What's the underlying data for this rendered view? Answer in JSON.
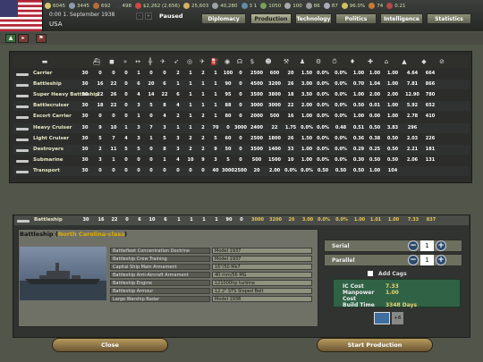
{
  "topbar": {
    "resources": [
      {
        "icon": "energy-icon",
        "value": "6045",
        "color": "#d6c66a"
      },
      {
        "icon": "metal-icon",
        "value": "3445",
        "color": "#8f9bb0"
      },
      {
        "icon": "rare-materials-icon",
        "value": "692",
        "color": "#b46d3a"
      },
      {
        "icon": "oil-icon",
        "value": "498",
        "color": "#3b3b3b"
      },
      {
        "icon": "supplies-icon",
        "value": "$2,262 (2,656)",
        "color": "#c94b43"
      },
      {
        "icon": "money-icon",
        "value": "25,603",
        "color": "#d5b15f"
      },
      {
        "icon": "manpower-icon",
        "value": "40,280",
        "color": "#9ca3a8"
      },
      {
        "icon": "transports-icon",
        "value": "3 1",
        "color": "#5f8ea8"
      },
      {
        "icon": "escorts-icon",
        "value": "1050",
        "color": "#78a05a"
      },
      {
        "icon": "dissent-icon",
        "value": "100",
        "color": "#aaaaaa"
      },
      {
        "icon": "leaders-icon",
        "value": "86",
        "color": "#9c9c9c"
      },
      {
        "icon": "diplo-icon",
        "value": "87",
        "color": "#aab"
      },
      {
        "icon": "national-unity-icon",
        "value": "96.0%",
        "color": "#d0c060"
      },
      {
        "icon": "officers-icon",
        "value": "74",
        "color": "#c97a3a"
      },
      {
        "icon": "war-icon",
        "value": "0.21",
        "color": "#b04a4a"
      }
    ],
    "date": "0:00 1. September 1938",
    "country": "USA",
    "paused_label": "Paused",
    "tabs": [
      "Diplomacy",
      "Production",
      "Technology",
      "Politics",
      "Intelligence",
      "Statistics"
    ],
    "active_tab": "Production"
  },
  "table": {
    "header_icons": [
      "ship-class-icon",
      "hull-icon",
      "armor-icon",
      "speed-icon",
      "range-icon",
      "gun-icon",
      "aa-icon",
      "torpedo-icon",
      "sub-attack-icon",
      "air-icon",
      "fuel-icon",
      "detection-icon",
      "visibility-icon",
      "dollar-icon",
      "crew-icon",
      "build-icon",
      "manpower-icon",
      "ic-icon",
      "time-icon",
      "strength-icon",
      "organization-icon",
      "upkeep-icon",
      "supply-icon",
      "ic-cost-icon",
      "unity-icon"
    ],
    "rows": [
      {
        "name": "Carrier",
        "values": [
          "30",
          "0",
          "0",
          "0",
          "1",
          "0",
          "0",
          "2",
          "1",
          "2",
          "1",
          "100",
          "0",
          "2500",
          "600",
          "20",
          "1.50",
          "0.0%",
          "0.0%",
          "1.00",
          "1.00",
          "1.00",
          "4.64",
          "664"
        ]
      },
      {
        "name": "Battleship",
        "values": [
          "30",
          "16",
          "22",
          "0",
          "6",
          "20",
          "6",
          "1",
          "1",
          "1",
          "1",
          "90",
          "0",
          "4500",
          "3200",
          "26",
          "3.00",
          "0.0%",
          "0.0%",
          "0.70",
          "1.04",
          "1.00",
          "7.81",
          "866"
        ]
      },
      {
        "name": "Super Heavy Battleship",
        "values": [
          "30",
          "22",
          "26",
          "0",
          "4",
          "14",
          "22",
          "6",
          "1",
          "1",
          "1",
          "95",
          "0",
          "3500",
          "3800",
          "18",
          "3.50",
          "0.0%",
          "0.0%",
          "1.00",
          "2.00",
          "2.00",
          "12.90",
          "780"
        ]
      },
      {
        "name": "Battlecruiser",
        "values": [
          "30",
          "18",
          "22",
          "0",
          "3",
          "5",
          "8",
          "4",
          "1",
          "1",
          "1",
          "88",
          "0",
          "3000",
          "3000",
          "22",
          "2.00",
          "0.0%",
          "0.0%",
          "0.50",
          "0.01",
          "1.00",
          "5.92",
          "652"
        ]
      },
      {
        "name": "Escort Carrier",
        "values": [
          "30",
          "0",
          "0",
          "0",
          "1",
          "0",
          "4",
          "2",
          "1",
          "2",
          "1",
          "80",
          "0",
          "2000",
          "500",
          "16",
          "1.00",
          "0.0%",
          "0.0%",
          "1.00",
          "0.00",
          "1.00",
          "2.78",
          "410"
        ]
      },
      {
        "name": "Heavy Cruiser",
        "values": [
          "30",
          "9",
          "10",
          "1",
          "3",
          "7",
          "3",
          "1",
          "1",
          "2",
          "70",
          "0",
          "3000",
          "2400",
          "22",
          "1.75",
          "0.0%",
          "0.0%",
          "0.48",
          "0.51",
          "0.50",
          "3.83",
          "296"
        ]
      },
      {
        "name": "Light Cruiser",
        "values": [
          "30",
          "5",
          "7",
          "4",
          "3",
          "1",
          "5",
          "3",
          "2",
          "2",
          "5",
          "60",
          "0",
          "2500",
          "1800",
          "26",
          "1.50",
          "0.0%",
          "0.0%",
          "0.36",
          "0.38",
          "0.50",
          "2.03",
          "226"
        ]
      },
      {
        "name": "Destroyers",
        "values": [
          "30",
          "2",
          "11",
          "5",
          "5",
          "0",
          "8",
          "3",
          "2",
          "2",
          "9",
          "50",
          "0",
          "3500",
          "1400",
          "33",
          "1.00",
          "0.0%",
          "0.0%",
          "0.29",
          "0.25",
          "0.50",
          "2.21",
          "181"
        ]
      },
      {
        "name": "Submarine",
        "values": [
          "30",
          "3",
          "1",
          "0",
          "0",
          "0",
          "1",
          "4",
          "10",
          "9",
          "3",
          "5",
          "0",
          "500",
          "1500",
          "10",
          "1.00",
          "0.0%",
          "0.0%",
          "0.30",
          "0.50",
          "0.50",
          "2.06",
          "131"
        ]
      },
      {
        "name": "Transport",
        "values": [
          "30",
          "0",
          "0",
          "0",
          "0",
          "0",
          "0",
          "0",
          "0",
          "0",
          "40",
          "3000",
          "2500",
          "20",
          "2.00",
          "0.0%",
          "0.0%",
          "0.50",
          "0.50",
          "0.50",
          "1.00",
          "104"
        ]
      }
    ],
    "selected": {
      "name": "Battleship",
      "values": [
        "30",
        "16",
        "22",
        "0",
        "6",
        "10",
        "6",
        "1",
        "1",
        "1",
        "1",
        "90",
        "0",
        "3000",
        "3200",
        "26",
        "3.00",
        "0.0%",
        "0.0%",
        "1.00",
        "1.01",
        "1.00",
        "7.33",
        "837"
      ]
    }
  },
  "detail": {
    "title_prefix": "Battleship (",
    "title_class": "North Carolina-class",
    "title_suffix": ")",
    "specs": [
      {
        "label": "Battlefleet Concentration Doctrine",
        "value": "Model 1937"
      },
      {
        "label": "Battleship Crew Training",
        "value": "Model 1937"
      },
      {
        "label": "Capital Ship Main Armament",
        "value": "16\"/50 Mk7"
      },
      {
        "label": "Battleship Anti-Aircraft Armament",
        "value": "40 mm/56 MG"
      },
      {
        "label": "Battleship Engine",
        "value": "121000hp turbine"
      },
      {
        "label": "Battleship Armour",
        "value": "12.2\" STS Sloped Belt"
      },
      {
        "label": "Large Warship Radar",
        "value": "Model 1938"
      }
    ]
  },
  "production": {
    "serial_label": "Serial",
    "serial_value": "1",
    "parallel_label": "Parallel",
    "parallel_value": "1",
    "add_cags_label": "Add Cags",
    "ic_cost_label": "IC Cost",
    "ic_cost": "7.33",
    "manpower_label": "Manpower Cost",
    "manpower": "1.00",
    "build_time_label": "Build Time",
    "build_time": "3348 Days",
    "unit_count": "+6"
  },
  "buttons": {
    "close": "Close",
    "start": "Start Production"
  }
}
